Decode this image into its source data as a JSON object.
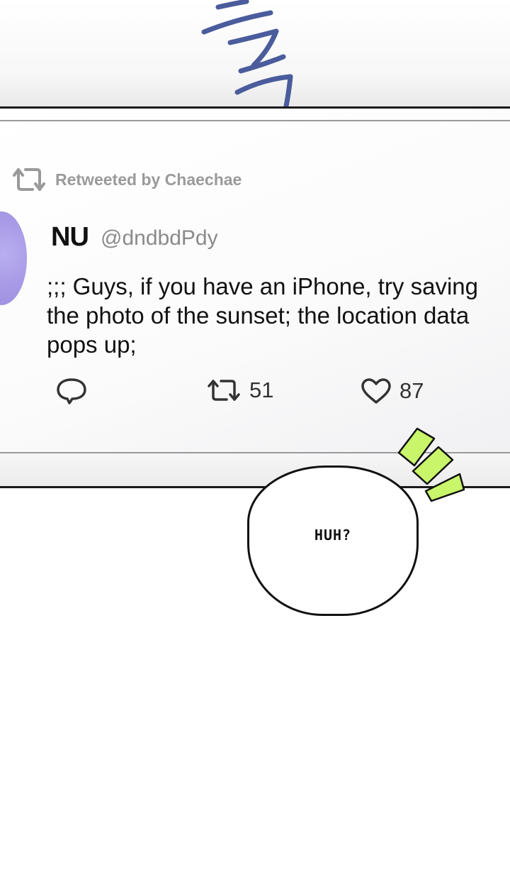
{
  "sfx": {
    "description_icon": "korean-sfx-strokes"
  },
  "tweet": {
    "retweeted_by": "Retweeted by Chaechae",
    "author_name": "NU",
    "author_handle": "@dndbdPdy",
    "text": ";;; Guys, if you have an iPhone, try saving the photo of the sunset; the location data pops up;",
    "retweet_count": "51",
    "like_count": "87"
  },
  "bubble": {
    "text": "HUH?"
  },
  "colors": {
    "avatar": "#a89ae6",
    "retweet_label": "#9a9a9a",
    "handle": "#8a8a8a",
    "sfx_green": "#c9f56a",
    "sfx_blue": "#4a5c9c"
  }
}
